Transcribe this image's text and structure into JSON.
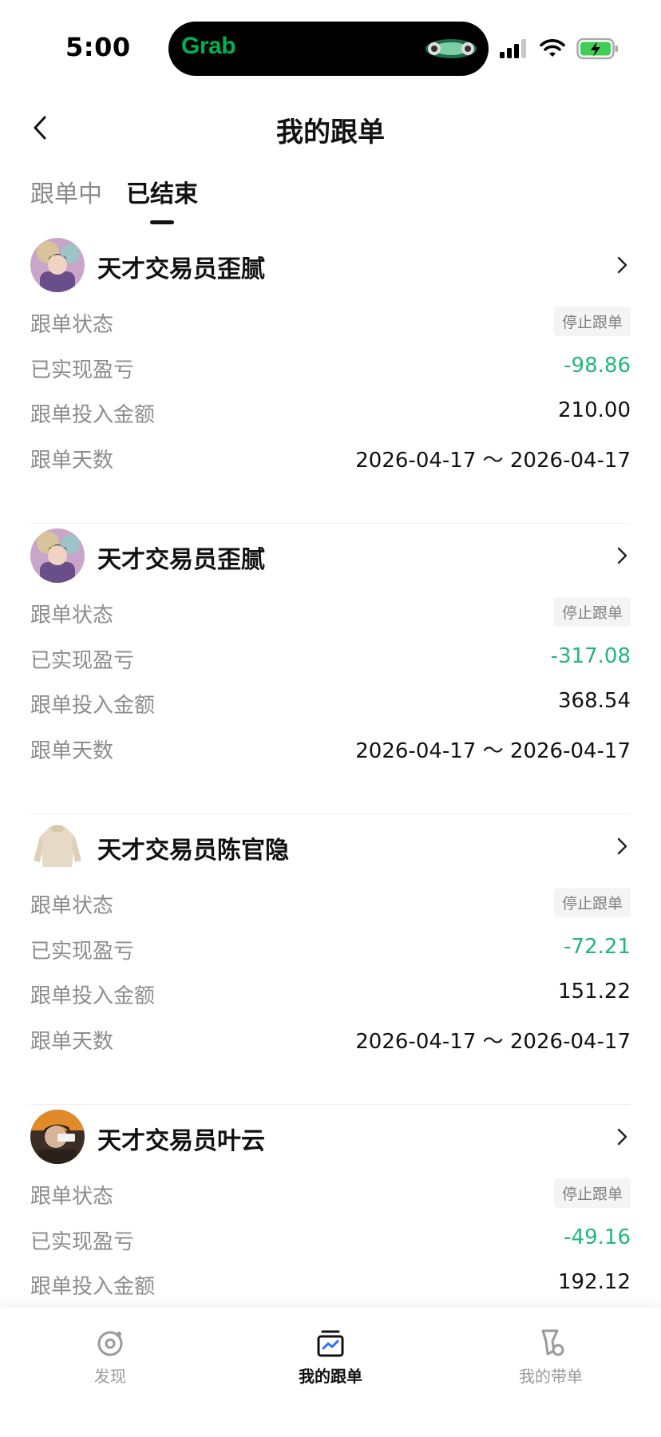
{
  "status_bar": {
    "time": "5:00",
    "island_app": "Grab",
    "icons": [
      "signal-icon",
      "wifi-icon",
      "battery-charging-icon"
    ]
  },
  "nav": {
    "title": "我的跟单",
    "back_icon": "chevron-left-icon"
  },
  "tabs": [
    {
      "label": "跟单中",
      "active": false
    },
    {
      "label": "已结束",
      "active": true
    }
  ],
  "labels": {
    "status": "跟单状态",
    "pnl": "已实现盈亏",
    "amount": "跟单投入金额",
    "days": "跟单天数"
  },
  "cards": [
    {
      "trader": "天才交易员歪腻",
      "status": "停止跟单",
      "pnl": "-98.86",
      "amount": "210.00",
      "days": "2026-04-17 ～ 2026-04-17"
    },
    {
      "trader": "天才交易员歪腻",
      "status": "停止跟单",
      "pnl": "-317.08",
      "amount": "368.54",
      "days": "2026-04-17 ～ 2026-04-17"
    },
    {
      "trader": "天才交易员陈官隐",
      "status": "停止跟单",
      "pnl": "-72.21",
      "amount": "151.22",
      "days": "2026-04-17 ～ 2026-04-17"
    },
    {
      "trader": "天才交易员叶云",
      "status": "停止跟单",
      "pnl": "-49.16",
      "amount": "192.12",
      "days": ""
    }
  ],
  "bottom_tabs": [
    {
      "label": "发现",
      "icon": "discover-icon",
      "active": false
    },
    {
      "label": "我的跟单",
      "icon": "copy-trading-icon",
      "active": true
    },
    {
      "label": "我的带单",
      "icon": "lead-trading-icon",
      "active": false
    }
  ],
  "colors": {
    "loss_green": "#20b77a",
    "brand_green": "#00b14f",
    "text_primary": "#111111",
    "text_secondary": "#8c8c8c"
  }
}
